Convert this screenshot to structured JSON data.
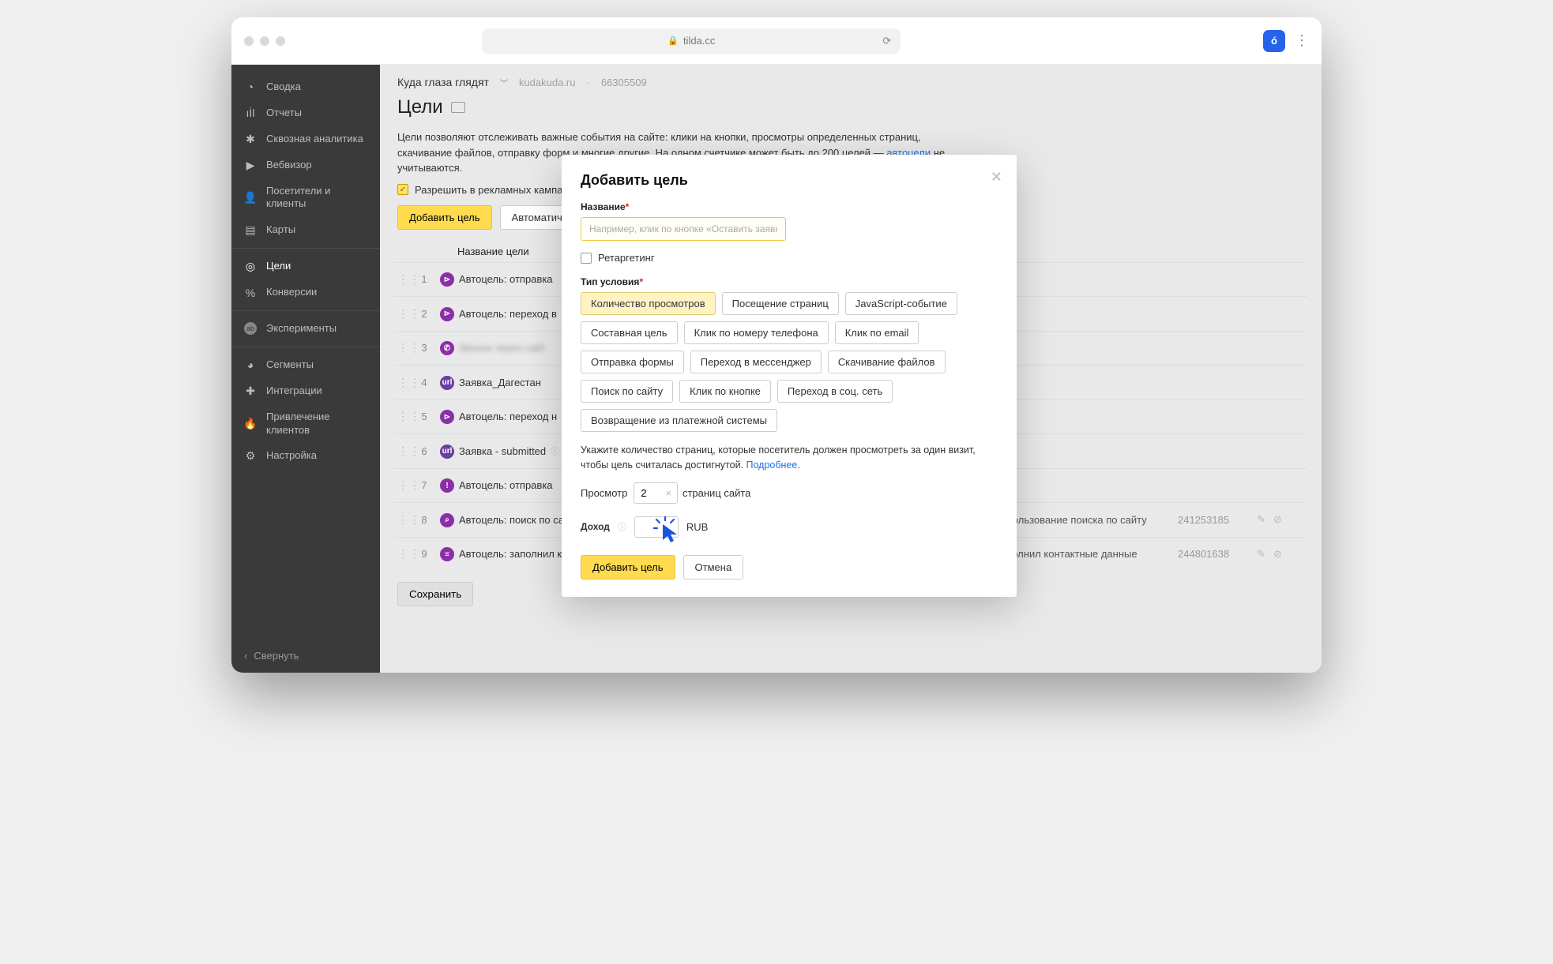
{
  "browser": {
    "url": "tilda.cc"
  },
  "sidebar": {
    "items": [
      {
        "label": "Сводка"
      },
      {
        "label": "Отчеты"
      },
      {
        "label": "Сквозная аналитика"
      },
      {
        "label": "Вебвизор"
      },
      {
        "label": "Посетители и клиенты"
      },
      {
        "label": "Карты"
      }
    ],
    "items2": [
      {
        "label": "Цели"
      },
      {
        "label": "Конверсии"
      }
    ],
    "items3": [
      {
        "label": "Эксперименты"
      }
    ],
    "items4": [
      {
        "label": "Сегменты"
      },
      {
        "label": "Интеграции"
      },
      {
        "label": "Привлечение клиентов"
      },
      {
        "label": "Настройка"
      }
    ],
    "collapse": "Свернуть"
  },
  "header": {
    "project": "Куда глаза глядят",
    "domain": "kudakuda.ru",
    "id": "66305509",
    "title": "Цели",
    "description_1": "Цели позволяют отслеживать важные события на сайте: клики на кнопки, просмотры определенных страниц, скачивание файлов, отправку форм и многие другие. На одном счетчике может быть до 200 целей — ",
    "description_link": "автоцели",
    "description_2": " не учитываются.",
    "checkbox_label": "Разрешить в рекламных кампания",
    "btn_add": "Добавить цель",
    "btn_auto": "Автоматическ",
    "btn_save": "Сохранить"
  },
  "table": {
    "col_name": "Название цели",
    "rows": [
      {
        "idx": "1",
        "ic": "p",
        "glyph": "⊳",
        "name": "Автоцель: отправка"
      },
      {
        "idx": "2",
        "ic": "p",
        "glyph": "⊳",
        "name": "Автоцель: переход в"
      },
      {
        "idx": "3",
        "ic": "p",
        "glyph": "✆",
        "name": "Звонок через сайт",
        "blur": true
      },
      {
        "idx": "4",
        "ic": "u",
        "glyph": "url",
        "name": "Заявка_Дагестан"
      },
      {
        "idx": "5",
        "ic": "p",
        "glyph": "⊳",
        "name": "Автоцель: переход н"
      },
      {
        "idx": "6",
        "ic": "u",
        "glyph": "url",
        "name": "Заявка - submitted",
        "info": true
      },
      {
        "idx": "7",
        "ic": "p",
        "glyph": "!",
        "name": "Автоцель: отправка"
      },
      {
        "idx": "8",
        "ic": "p",
        "glyph": "⌕",
        "name": "Автоцель: поиск по сайту",
        "info": true,
        "desc": "использование поиска по сайту",
        "id": "241253185",
        "actions": true
      },
      {
        "idx": "9",
        "ic": "p",
        "glyph": "≡",
        "name": "Автоцель: заполнил контактные данные",
        "info": true,
        "desc": "заполнил контактные данные",
        "id": "244801638",
        "actions": true
      }
    ]
  },
  "modal": {
    "title": "Добавить цель",
    "name_label": "Название",
    "name_placeholder": "Например, клик по кнопке «Оставить заявку»",
    "retarget": "Ретаргетинг",
    "type_label": "Тип условия",
    "chips": [
      "Количество просмотров",
      "Посещение страниц",
      "JavaScript-событие",
      "Составная цель",
      "Клик по номеру телефона",
      "Клик по email",
      "Отправка формы",
      "Переход в мессенджер",
      "Скачивание файлов",
      "Поиск по сайту",
      "Клик по кнопке",
      "Переход в соц. сеть",
      "Возвращение из платежной системы"
    ],
    "help_1": "Укажите количество страниц, которые посетитель должен просмотреть за один визит, чтобы цель считалась достигнутой. ",
    "help_link": "Подробнее",
    "views_pre": "Просмотр",
    "views_val": "2",
    "views_post": "страниц сайта",
    "income_label": "Доход",
    "income_cur": "RUB",
    "btn_add": "Добавить цель",
    "btn_cancel": "Отмена"
  }
}
